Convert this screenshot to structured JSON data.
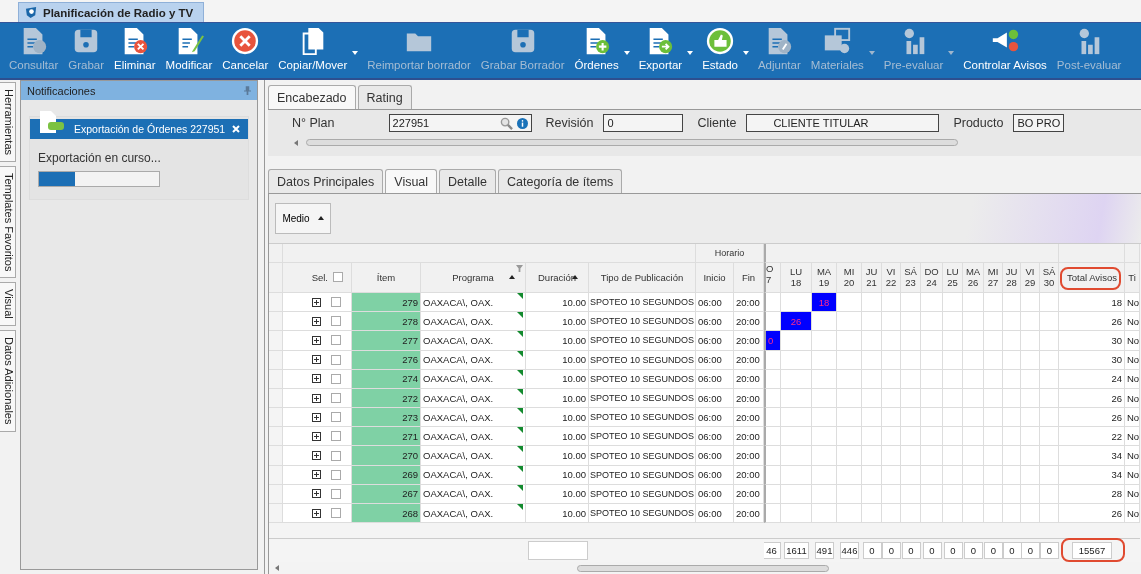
{
  "app_tab": {
    "title": "Planificación de Radio y TV"
  },
  "toolbar": [
    {
      "label": "Consultar",
      "kind": "doc-query",
      "disabled": true,
      "dropdown": false
    },
    {
      "label": "Grabar",
      "kind": "disk",
      "disabled": true,
      "dropdown": false
    },
    {
      "label": "Eliminar",
      "kind": "doc-delete",
      "disabled": false,
      "dropdown": false
    },
    {
      "label": "Modificar",
      "kind": "doc-edit",
      "disabled": false,
      "dropdown": false
    },
    {
      "label": "Cancelar",
      "kind": "cancel",
      "disabled": false,
      "dropdown": false
    },
    {
      "label": "Copiar/Mover",
      "kind": "copy",
      "disabled": false,
      "dropdown": true
    },
    {
      "label": "Reimportar borrador",
      "kind": "folder",
      "disabled": true,
      "dropdown": false
    },
    {
      "label": "Grabar Borrador",
      "kind": "disk",
      "disabled": true,
      "dropdown": false
    },
    {
      "label": "Órdenes",
      "kind": "doc-add",
      "disabled": false,
      "dropdown": true
    },
    {
      "label": "Exportar",
      "kind": "doc-export",
      "disabled": false,
      "dropdown": true
    },
    {
      "label": "Estado",
      "kind": "thumb",
      "disabled": false,
      "dropdown": true
    },
    {
      "label": "Adjuntar",
      "kind": "doc-attach",
      "disabled": true,
      "dropdown": false
    },
    {
      "label": "Materiales",
      "kind": "media",
      "disabled": true,
      "dropdown": true
    },
    {
      "label": "Pre-evaluar",
      "kind": "chart",
      "disabled": true,
      "dropdown": true
    },
    {
      "label": "Controlar Avisos",
      "kind": "megaphone",
      "disabled": false,
      "dropdown": false
    },
    {
      "label": "Post-evaluar",
      "kind": "chart",
      "disabled": true,
      "dropdown": false
    }
  ],
  "side_tabs": [
    "Herramientas",
    "Templates Favoritos",
    "Visual",
    "Datos Adicionales"
  ],
  "notifications": {
    "title": "Notificaciones",
    "card": {
      "title": "Exportación de Órdenes 227951",
      "message": "Exportación en curso...",
      "level": 0.3
    }
  },
  "header_tabs": [
    {
      "label": "Encabezado",
      "selected": true
    },
    {
      "label": "Rating",
      "selected": false
    }
  ],
  "fields": [
    {
      "label": "N° Plan",
      "value": "227951",
      "kind": "lookup"
    },
    {
      "label": "Revisión",
      "value": "0",
      "kind": "short"
    },
    {
      "label": "Cliente",
      "value": "CLIENTE TITULAR",
      "kind": "wide"
    },
    {
      "label": "Producto",
      "value": "BO PRO",
      "kind": "cut"
    }
  ],
  "detail_tabs": [
    {
      "label": "Datos Principales",
      "selected": false
    },
    {
      "label": "Visual",
      "selected": true
    },
    {
      "label": "Detalle",
      "selected": false
    },
    {
      "label": "Categoría de ítems",
      "selected": false
    }
  ],
  "group_button": {
    "label": "Medio"
  },
  "grid": {
    "group_header": "Horario",
    "select_label": "Sel.",
    "select_all_checked": false,
    "columns": [
      "Ítem",
      "Programa",
      "Duración",
      "Tipo de Publicación",
      "Inicio",
      "Fin"
    ],
    "days": [
      {
        "day": "O",
        "date": "7"
      },
      {
        "day": "LU",
        "date": "18"
      },
      {
        "day": "MA",
        "date": "19"
      },
      {
        "day": "MI",
        "date": "20"
      },
      {
        "day": "JU",
        "date": "21"
      },
      {
        "day": "VI",
        "date": "22"
      },
      {
        "day": "SÁ",
        "date": "23"
      },
      {
        "day": "DO",
        "date": "24"
      },
      {
        "day": "LU",
        "date": "25"
      },
      {
        "day": "MA",
        "date": "26"
      },
      {
        "day": "MI",
        "date": "27"
      },
      {
        "day": "JU",
        "date": "28"
      },
      {
        "day": "VI",
        "date": "29"
      },
      {
        "day": "SÁ",
        "date": "30"
      }
    ],
    "total_header": {
      "label": "Total Avisos",
      "circled": true
    },
    "last_header": "Ti",
    "rows": [
      {
        "item": "279",
        "programa": "OAXACA\\, OAX.",
        "duracion": "10.00",
        "tipo": "SPOTEO 10 SEGUNDOS",
        "inicio": "06:00",
        "fin": "20:00",
        "day_cells": [
          null,
          null,
          "18",
          null,
          null,
          null,
          null,
          null,
          null,
          null,
          null,
          null,
          null,
          null
        ],
        "total": "18",
        "last": "No",
        "checked": false
      },
      {
        "item": "278",
        "programa": "OAXACA\\, OAX.",
        "duracion": "10.00",
        "tipo": "SPOTEO 10 SEGUNDOS",
        "inicio": "06:00",
        "fin": "20:00",
        "day_cells": [
          null,
          "26",
          null,
          null,
          null,
          null,
          null,
          null,
          null,
          null,
          null,
          null,
          null,
          null
        ],
        "total": "26",
        "last": "No",
        "checked": false
      },
      {
        "item": "277",
        "programa": "OAXACA\\, OAX.",
        "duracion": "10.00",
        "tipo": "SPOTEO 10 SEGUNDOS",
        "inicio": "06:00",
        "fin": "20:00",
        "day_cells": [
          "0",
          null,
          null,
          null,
          null,
          null,
          null,
          null,
          null,
          null,
          null,
          null,
          null,
          null
        ],
        "total": "30",
        "last": "No",
        "checked": false
      },
      {
        "item": "276",
        "programa": "OAXACA\\, OAX.",
        "duracion": "10.00",
        "tipo": "SPOTEO 10 SEGUNDOS",
        "inicio": "06:00",
        "fin": "20:00",
        "total": "30",
        "last": "No",
        "checked": false
      },
      {
        "item": "274",
        "programa": "OAXACA\\, OAX.",
        "duracion": "10.00",
        "tipo": "SPOTEO 10 SEGUNDOS",
        "inicio": "06:00",
        "fin": "20:00",
        "total": "24",
        "last": "No",
        "checked": false
      },
      {
        "item": "272",
        "programa": "OAXACA\\, OAX.",
        "duracion": "10.00",
        "tipo": "SPOTEO 10 SEGUNDOS",
        "inicio": "06:00",
        "fin": "20:00",
        "total": "26",
        "last": "No",
        "checked": false
      },
      {
        "item": "273",
        "programa": "OAXACA\\, OAX.",
        "duracion": "10.00",
        "tipo": "SPOTEO 10 SEGUNDOS",
        "inicio": "06:00",
        "fin": "20:00",
        "total": "26",
        "last": "No",
        "checked": false
      },
      {
        "item": "271",
        "programa": "OAXACA\\, OAX.",
        "duracion": "10.00",
        "tipo": "SPOTEO 10 SEGUNDOS",
        "inicio": "06:00",
        "fin": "20:00",
        "total": "22",
        "last": "No",
        "checked": false
      },
      {
        "item": "270",
        "programa": "OAXACA\\, OAX.",
        "duracion": "10.00",
        "tipo": "SPOTEO 10 SEGUNDOS",
        "inicio": "06:00",
        "fin": "20:00",
        "total": "34",
        "last": "No",
        "checked": false
      },
      {
        "item": "269",
        "programa": "OAXACA\\, OAX.",
        "duracion": "10.00",
        "tipo": "SPOTEO 10 SEGUNDOS",
        "inicio": "06:00",
        "fin": "20:00",
        "total": "34",
        "last": "No",
        "checked": false
      },
      {
        "item": "267",
        "programa": "OAXACA\\, OAX.",
        "duracion": "10.00",
        "tipo": "SPOTEO 10 SEGUNDOS",
        "inicio": "06:00",
        "fin": "20:00",
        "total": "28",
        "last": "No",
        "checked": false
      },
      {
        "item": "268",
        "programa": "OAXACA\\, OAX.",
        "duracion": "10.00",
        "tipo": "SPOTEO 10 SEGUNDOS",
        "inicio": "06:00",
        "fin": "20:00",
        "total": "26",
        "last": "No",
        "checked": false
      }
    ],
    "footer": {
      "day_totals": [
        "46",
        "1611",
        "491",
        "446",
        "0",
        "0",
        "0",
        "0",
        "0",
        "0",
        "0",
        "0",
        "0",
        "0"
      ],
      "total": {
        "value": "15567",
        "circled": true
      }
    }
  }
}
